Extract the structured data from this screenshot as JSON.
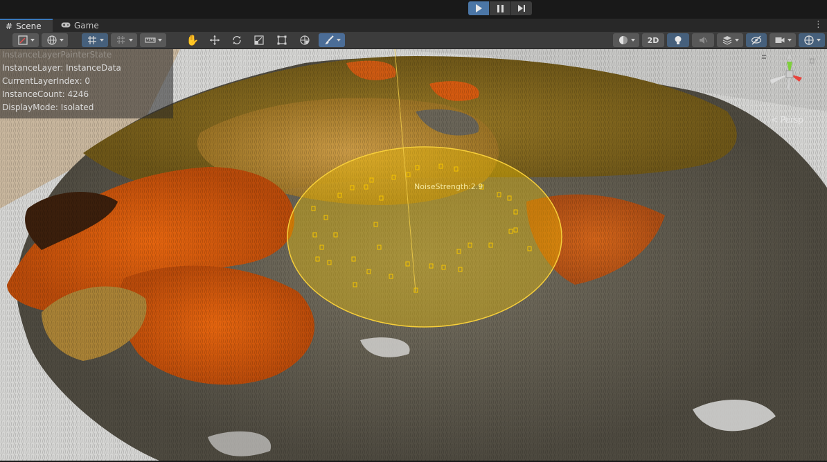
{
  "playbar": {
    "play_icon": "play-icon",
    "pause_icon": "pause-icon",
    "step_icon": "step-icon",
    "active_color": "#4b76a6"
  },
  "tabs": [
    {
      "label": "Scene",
      "icon": "grid-hash-icon"
    },
    {
      "label": "Game",
      "icon": "gamepad-icon"
    }
  ],
  "toolbar": {
    "left_tools": [
      "draw-mode-icon",
      "globe-icon",
      "grid-snap-icon",
      "increment-snap-icon",
      "ruler-icon"
    ],
    "transform_tools": [
      "hand-icon",
      "move-icon",
      "rotate-icon",
      "scale-icon",
      "rect-icon",
      "transform-icon",
      "brush-icon"
    ],
    "right_tools": [
      "shading-sphere-icon",
      "lighting-icon",
      "audio-icon",
      "effects-icon",
      "visibility-icon",
      "camera-icon",
      "gizmos-icon"
    ],
    "two_d_label": "2D"
  },
  "overlay": {
    "line0": "InstanceLayerPainterState",
    "line1": "InstanceLayer: InstanceData",
    "line2": "CurrentLayerIndex: 0",
    "line3": "InstanceCount: 4246",
    "line4": "DisplayMode: Isolated"
  },
  "viewport": {
    "noise_label": "NoiseStrength:2.9",
    "persp_label": "< Persp",
    "brush_color": "#f5c400"
  },
  "colors": {
    "accent_blue": "#3a79bb",
    "grass_orange": "#e0600f",
    "grass_gray": "#6b6556",
    "grass_gold": "#b8902e"
  }
}
